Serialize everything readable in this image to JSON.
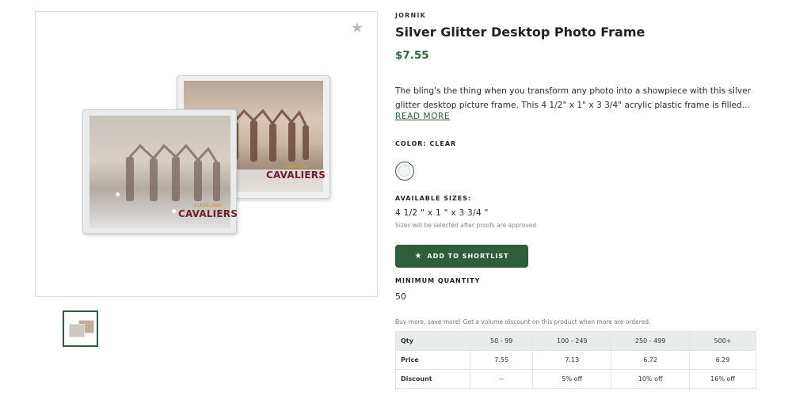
{
  "product": {
    "brand": "JORNIK",
    "title": "Silver Glitter Desktop Photo Frame",
    "price": "$7.55",
    "description": "The bling's the thing when you transform any photo into a showpiece with this silver glitter desktop picture frame. This 4 1/2\" x 1\" x 3 3/4\" acrylic plastic frame is filled...",
    "read_more": "READ MORE"
  },
  "gallery": {
    "favorite_icon": "star-icon",
    "image_logo_small": "CLEVELAND",
    "image_logo_big": "CAVALIERS"
  },
  "color": {
    "label": "COLOR: CLEAR",
    "swatch_color": "#f0f5f8"
  },
  "sizes": {
    "label": "AVAILABLE SIZES:",
    "value": "4 1/2 \" x 1 \" x 3 3/4 \"",
    "note": "Sizes will be selected after proofs are approved"
  },
  "shortlist": {
    "label": "ADD TO SHORTLIST",
    "icon": "star-icon"
  },
  "minimum": {
    "label": "MINIMUM QUANTITY",
    "value": "50"
  },
  "pricing": {
    "note": "Buy more, save more! Get a volume discount on this product when more are ordered.",
    "header": [
      "Qty",
      "50 - 99",
      "100 - 249",
      "250 - 499",
      "500+"
    ],
    "rows": [
      [
        "Price",
        "7.55",
        "7.13",
        "6.72",
        "6.29"
      ],
      [
        "Discount",
        "--",
        "5% off",
        "10% off",
        "16% off"
      ]
    ]
  },
  "colors": {
    "accent": "#2e5e3a",
    "price": "#2e6a3c"
  }
}
